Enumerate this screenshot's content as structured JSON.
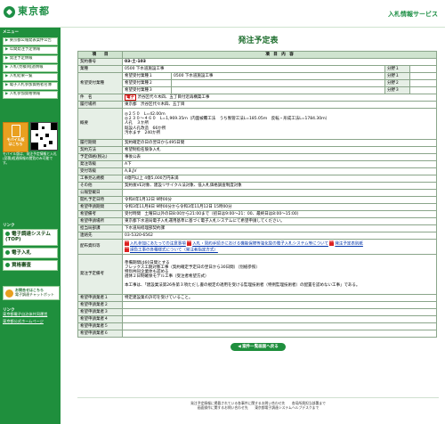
{
  "header": {
    "logo_text": "東京都",
    "site_title": "入札情報サービス"
  },
  "sidebar": {
    "menu_head": "メニュー",
    "items": [
      {
        "mark": "▶",
        "label": "東京都公報発表案件公告"
      },
      {
        "mark": "▶",
        "label": "年間発注予定情報"
      },
      {
        "mark": "▶",
        "label": "発注予定情報"
      },
      {
        "mark": "▶",
        "label": "入札(見積)経過情報"
      },
      {
        "mark": "▶",
        "label": "入札結果一覧"
      },
      {
        "mark": "▶",
        "label": "電子入札参加資格者名簿"
      },
      {
        "mark": "▶",
        "label": "入札参加資格情報"
      }
    ],
    "mobile_label": "モバイル版",
    "mobile_sub": "はこちら",
    "mobile_note": "モバイル版は、発注予定情報と入札(見積)経過情報の閲覧のみ可能です。",
    "links_head": "リンク",
    "links": [
      {
        "label": "電子調達システム(TOP)"
      },
      {
        "label": "電子入札"
      },
      {
        "label": "資格審査"
      }
    ],
    "chat": {
      "line1": "お問合せはこちら",
      "line2": "電子調達チャットボット"
    },
    "ext_head": "リンク",
    "ext_links": [
      "東京都電子自治体共同運営",
      "東京都公式ホームページ"
    ]
  },
  "main": {
    "page_title": "発注予定表",
    "col_item": "項　　目",
    "col_content": "項　目　内　容",
    "rows": {
      "keiyaku_no": {
        "label": "契約番号",
        "value": "03-土-103"
      },
      "gyoshu": {
        "label": "業種",
        "value": "0500 下水道施設工事",
        "bun_label": "分野１",
        "bun_value": ""
      },
      "kibo_label": "希望受付業種",
      "kibo": [
        {
          "sub": "希望受付業種１",
          "value": "0500 下水道施設工事",
          "bun_label": "分野１",
          "bun_value": ""
        },
        {
          "sub": "希望受付業種２",
          "value": "",
          "bun_label": "分野２",
          "bun_value": ""
        },
        {
          "sub": "希望受付業種３",
          "value": "",
          "bun_label": "分野３",
          "bun_value": ""
        }
      ],
      "kenmei": {
        "label": "件　名",
        "badge": "電子",
        "value": "渋谷区代々木四、五丁目付近再構築工事"
      },
      "basho": {
        "label": "履行場所",
        "value": "東京都　渋谷区代々木四、五丁目"
      },
      "gaiyo": {
        "label": "概要",
        "lines": [
          "◎２５０　L=42.00ｍ",
          "◎２３０～４６０　L=1,969.35ｍ（内面被覆工法　うち製管工法L=185.05ｍ　反転・形成工法L=1784.30ｍ）",
          "人孔　３か所",
          "既設人孔改造　66か所",
          "汚水ます　240か所"
        ]
      },
      "kikan": {
        "label": "履行期間",
        "value": "契約確定の日の翌日から495日間"
      },
      "hoho": {
        "label": "契約方法",
        "value": "希望制指名競争入札"
      },
      "yotei": {
        "label": "予定価格(税込)",
        "value": "事後公表"
      },
      "hatchu_rank": {
        "label": "発注等級",
        "value": "A下"
      },
      "uketsuke": {
        "label": "受付等級",
        "value": "A,B,JV"
      },
      "kibo_kakaku": {
        "label": "工事見込規模",
        "value": "4億円以上 4億5,000万円未満"
      },
      "sonota": {
        "label": "その他",
        "value": "契約後VE対象、建設リサイクル法対象、低入札価格調査制度対象"
      },
      "koho_bi": {
        "label": "公報登載日",
        "value": ""
      },
      "kaihei": {
        "label": "開札予定日時",
        "value": "令和4年1月12日 9時00分"
      },
      "shinsei": {
        "label": "希望申請期間",
        "value": "令和3年11月8日 9時00分から令和3年11月12日 15時00分"
      },
      "bikou": {
        "label": "希望備考",
        "value": "受付時間　土曜日以外の日8:00から21:00まで（初日は9:00～21：00、最終日は8:00～15:00）"
      },
      "hoshiki": {
        "label": "希望申請場所",
        "value": "東京都下水道局電子入札運用基準に基づく電子入札システムにて希望申請してください。"
      },
      "tanto": {
        "label": "担当局部課",
        "value": "下水道局経理部契約課"
      },
      "renraku": {
        "label": "連絡先",
        "value": "03-5320-6562"
      },
      "haifu": {
        "label": "配布資料等",
        "docs": [
          "入札参加にあたっての注意事項",
          "入札・契約手続きにおける機能保障等強化型の電子入札システム等について",
          "発注予定表別紙",
          "請負工事の各種様式について（発注者指定方式）"
        ]
      },
      "bikou2": {
        "label": "発注予定備考",
        "lines": [
          "準備期間は60日間とする",
          "フレックス工期対象工事（契約確定予定日の翌日から30日間）（別紙参照）",
          "特別共同企業体も認める",
          "週休２日制確保モデル工事（受注者希望方式）",
          "",
          "本工事は、「建設業法第26条第３項ただし書の規定の適用を受ける監理技術者（特例監理技術者）の配置を認めない工事」である。"
        ]
      },
      "kibo_shinsei": [
        {
          "label": "希望申請業者１",
          "value": "特定建設業の許可を受けていること。"
        },
        {
          "label": "希望申請業者２",
          "value": ""
        },
        {
          "label": "希望申請業者３",
          "value": ""
        },
        {
          "label": "希望申請業者４",
          "value": ""
        },
        {
          "label": "希望申請業者５",
          "value": ""
        },
        {
          "label": "希望申請業者６",
          "value": ""
        }
      ]
    },
    "back_label": "◀ 案件一覧画面へ戻る"
  },
  "footer": {
    "line1": "発注予定情報に掲載されている各事件に関するお問い合わせ先　　各局所属担当部署まで",
    "line2": "画面操作に関するお問い合わせ先　　東京都電子調達システムヘルプデスクまで"
  }
}
